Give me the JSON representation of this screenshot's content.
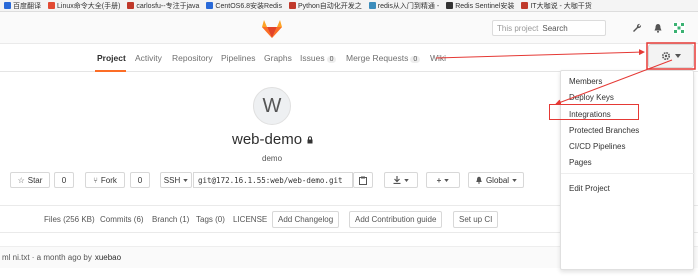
{
  "bookmarks": [
    {
      "label": "百度翻译",
      "color": "#2a6ad8"
    },
    {
      "label": "Linux命令大全(手册)",
      "color": "#e24a33"
    },
    {
      "label": "carlosfu--专注于java",
      "color": "#c0392b"
    },
    {
      "label": "CentOS6.8安装Redis",
      "color": "#2a6ad8"
    },
    {
      "label": "Python自动化开发之",
      "color": "#c0392b"
    },
    {
      "label": "redis从入门到精通 -",
      "color": "#3c8dbc"
    },
    {
      "label": "Redis Sentinel安装",
      "color": "#333333"
    },
    {
      "label": "IT大咖说 - 大咖干货",
      "color": "#c0392b"
    }
  ],
  "header": {
    "search_scope": "This project",
    "search_placeholder": "Search"
  },
  "nav": {
    "project": "Project",
    "activity": "Activity",
    "repository": "Repository",
    "pipelines": "Pipelines",
    "graphs": "Graphs",
    "issues": "Issues",
    "issues_count": "0",
    "merge_requests": "Merge Requests",
    "mr_count": "0",
    "wiki": "Wiki"
  },
  "project": {
    "avatar_letter": "W",
    "name": "web-demo",
    "subtitle": "demo"
  },
  "actions": {
    "star": "Star",
    "star_count": "0",
    "fork": "Fork",
    "fork_count": "0",
    "protocol": "SSH",
    "clone_url": "git@172.16.1.55:web/web-demo.git",
    "visibility": "Global"
  },
  "stats": {
    "files": "Files (256 KB)",
    "commits": "Commits (6)",
    "branch": "Branch (1)",
    "tags": "Tags (0)",
    "license": "LICENSE",
    "add_changelog": "Add Changelog",
    "add_contribution": "Add Contribution guide",
    "setup_ci": "Set up CI"
  },
  "commit": {
    "text": "ml ni.txt · a month ago by",
    "author": "xuebao"
  },
  "dropdown": {
    "items": [
      "Members",
      "Deploy Keys",
      "Integrations",
      "Protected Branches",
      "CI/CD Pipelines",
      "Pages",
      "Edit Project"
    ]
  },
  "colors": {
    "accent": "#fc6d26",
    "annotation": "#e53935"
  }
}
